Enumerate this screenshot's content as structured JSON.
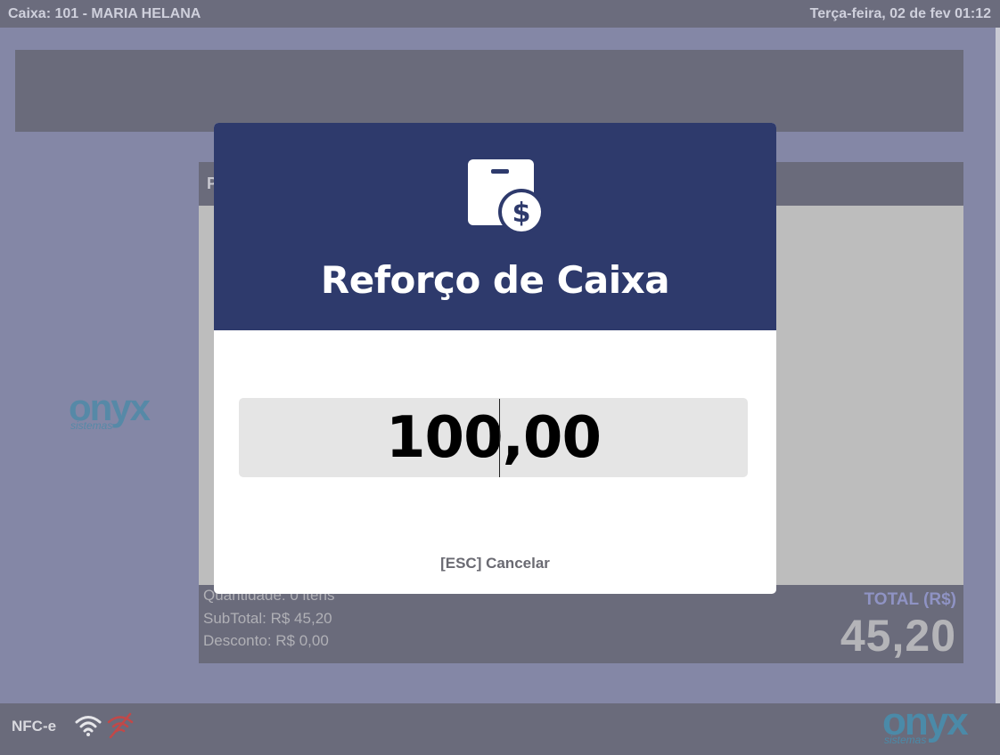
{
  "topbar": {
    "register": "Caixa: 101 - MARIA HELANA",
    "datetime": "Terça-feira, 02 de fev 01:12"
  },
  "panel": {
    "header_initial": "P",
    "quantity": "Quantidade: 0 itens",
    "subtotal": "SubTotal: R$ 45,20",
    "discount": "Desconto: R$ 0,00",
    "total_label": "TOTAL (R$)",
    "total_value": "45,20"
  },
  "logo": {
    "text": "onyx",
    "sub": "sistemas"
  },
  "bottombar": {
    "nfce": "NFC-e",
    "icons": [
      "wifi-icon",
      "wifi-off-icon"
    ]
  },
  "modal": {
    "icon": "cash-register-dollar-icon",
    "title": "Reforço de Caixa",
    "amount": "100,00",
    "cancel_label": "[ESC] Cancelar"
  },
  "colors": {
    "header_blue": "#2e3a6c",
    "background": "#8487a6",
    "bars": "#6a6b7b",
    "logo": "#4b8aa8"
  }
}
